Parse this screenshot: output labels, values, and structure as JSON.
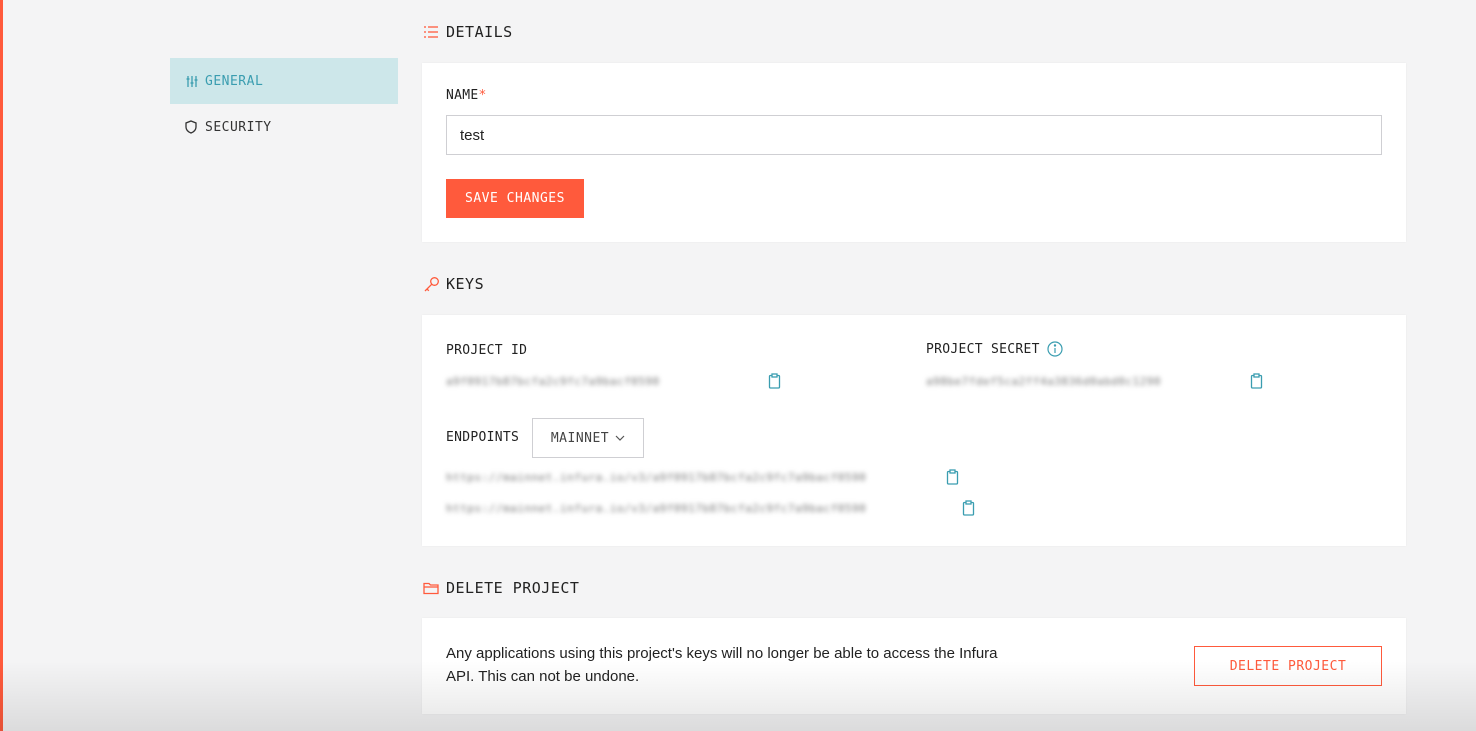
{
  "colors": {
    "accent": "#ff5a3c",
    "active_bg": "#cde7ea",
    "active_text": "#3a9db0",
    "link": "#3a9db0"
  },
  "sidebar": {
    "items": [
      {
        "label": "GENERAL",
        "icon": "sliders-icon",
        "active": true
      },
      {
        "label": "SECURITY",
        "icon": "shield-icon",
        "active": false
      }
    ]
  },
  "details": {
    "title": "DETAILS",
    "name_label": "NAME",
    "required_mark": "*",
    "name_value": "test",
    "save_label": "SAVE CHANGES"
  },
  "keys": {
    "title": "KEYS",
    "project_id_label": "PROJECT ID",
    "project_id_value": "a9f0917b87bcfa2c9fc7a9bacf0590",
    "project_secret_label": "PROJECT SECRET",
    "project_secret_value": "a98be7fdef5ca2ff4a3836d0abd0c1290",
    "endpoints_label": "ENDPOINTS",
    "network_selected": "MAINNET",
    "endpoints": [
      "https://mainnet.infura.io/v3/a9f0917b87bcfa2c9fc7a9bacf0590",
      "https://mainnet.infura.io/v3/a9f0917b87bcfa2c9fc7a9bacf0590"
    ]
  },
  "delete": {
    "title": "DELETE PROJECT",
    "description": "Any applications using this project's keys will no longer be able to access the Infura API. This can not be undone.",
    "button_label": "DELETE PROJECT"
  }
}
